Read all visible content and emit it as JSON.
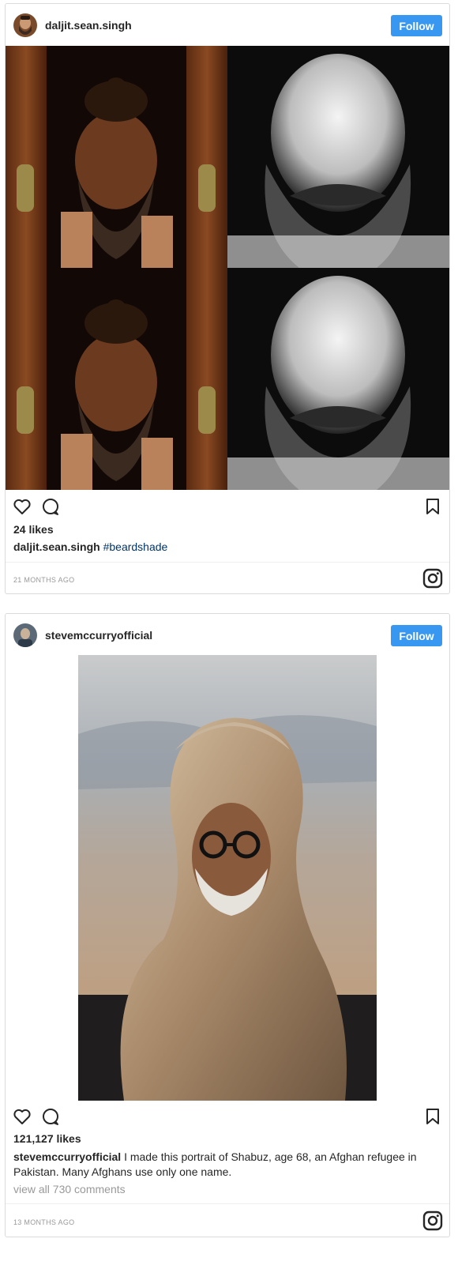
{
  "posts": [
    {
      "username": "daljit.sean.singh",
      "follow_label": "Follow",
      "media_icon": "portrait-collage-image",
      "likes": "24 likes",
      "caption_user": "daljit.sean.singh",
      "caption_text": "",
      "hashtag": "#beardshade",
      "time": "21 MONTHS AGO"
    },
    {
      "username": "stevemccurryofficial",
      "follow_label": "Follow",
      "media_icon": "turban-portrait-image",
      "likes": "121,127 likes",
      "caption_user": "stevemccurryofficial",
      "caption_text": " I made this portrait of Shabuz, age 68, an Afghan refugee in Pakistan. Many Afghans use only one name.",
      "view_all": "view all 730 comments",
      "time": "13 MONTHS AGO"
    }
  ],
  "colors": {
    "follow_bg": "#3897f0",
    "border": "#dbdbdb",
    "hashtag": "#003569",
    "muted": "#999999"
  },
  "icons": [
    "heart-icon",
    "comment-icon",
    "bookmark-icon",
    "instagram-logo-icon"
  ]
}
